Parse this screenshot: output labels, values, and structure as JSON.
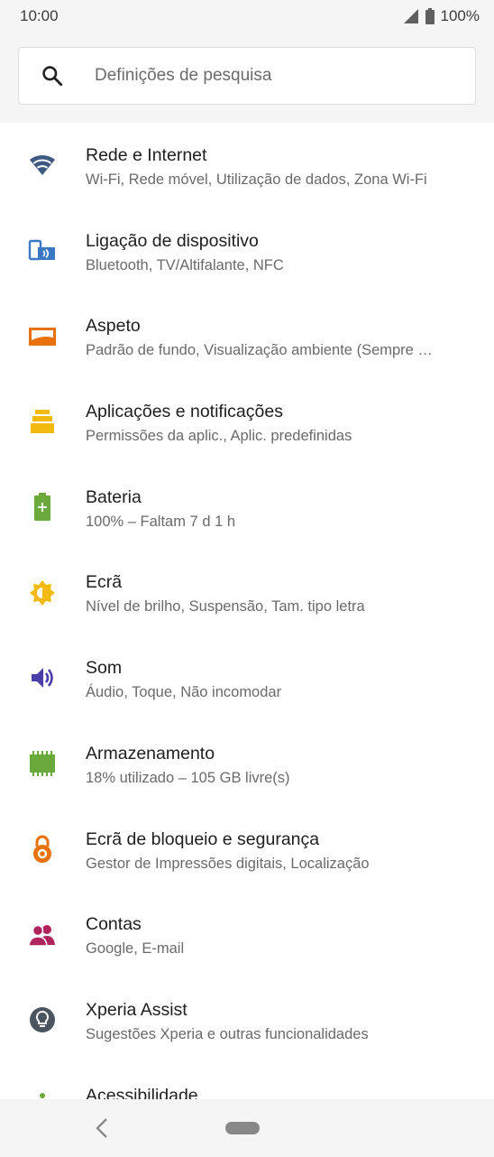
{
  "status_bar": {
    "time": "10:00",
    "battery_text": "100%"
  },
  "search": {
    "placeholder": "Definições de pesquisa"
  },
  "settings": [
    {
      "title": "Rede e Internet",
      "subtitle": "Wi-Fi, Rede móvel, Utilização de dados, Zona Wi-Fi",
      "icon": "wifi-icon",
      "color": "#3d5a80"
    },
    {
      "title": "Ligação de dispositivo",
      "subtitle": "Bluetooth, TV/Altifalante, NFC",
      "icon": "device-connection-icon",
      "color": "#3b78c4"
    },
    {
      "title": "Aspeto",
      "subtitle": "Padrão de fundo, Visualização ambiente (Sempre …",
      "icon": "wallpaper-icon",
      "color": "#e8710a"
    },
    {
      "title": "Aplicações e notificações",
      "subtitle": "Permissões da aplic., Aplic. predefinidas",
      "icon": "apps-icon",
      "color": "#f2b90f"
    },
    {
      "title": "Bateria",
      "subtitle": "100% – Faltam 7 d 1 h",
      "icon": "battery-icon",
      "color": "#6aaa3c"
    },
    {
      "title": "Ecrã",
      "subtitle": "Nível de brilho, Suspensão, Tam. tipo letra",
      "icon": "brightness-icon",
      "color": "#f2b90f"
    },
    {
      "title": "Som",
      "subtitle": "Áudio, Toque, Não incomodar",
      "icon": "sound-icon",
      "color": "#4a3ea8"
    },
    {
      "title": "Armazenamento",
      "subtitle": "18% utilizado – 105 GB livre(s)",
      "icon": "storage-icon",
      "color": "#6aaa3c"
    },
    {
      "title": "Ecrã de bloqueio e segurança",
      "subtitle": "Gestor de Impressões digitais, Localização",
      "icon": "lock-icon",
      "color": "#e8710a"
    },
    {
      "title": "Contas",
      "subtitle": "Google, E-mail",
      "icon": "accounts-icon",
      "color": "#b0245e"
    },
    {
      "title": "Xperia Assist",
      "subtitle": "Sugestões Xperia e outras funcionalidades",
      "icon": "lightbulb-icon",
      "color": "#4a5560"
    },
    {
      "title": "Acessibilidade",
      "subtitle": "",
      "icon": "accessibility-icon",
      "color": "#6aaa3c"
    }
  ]
}
